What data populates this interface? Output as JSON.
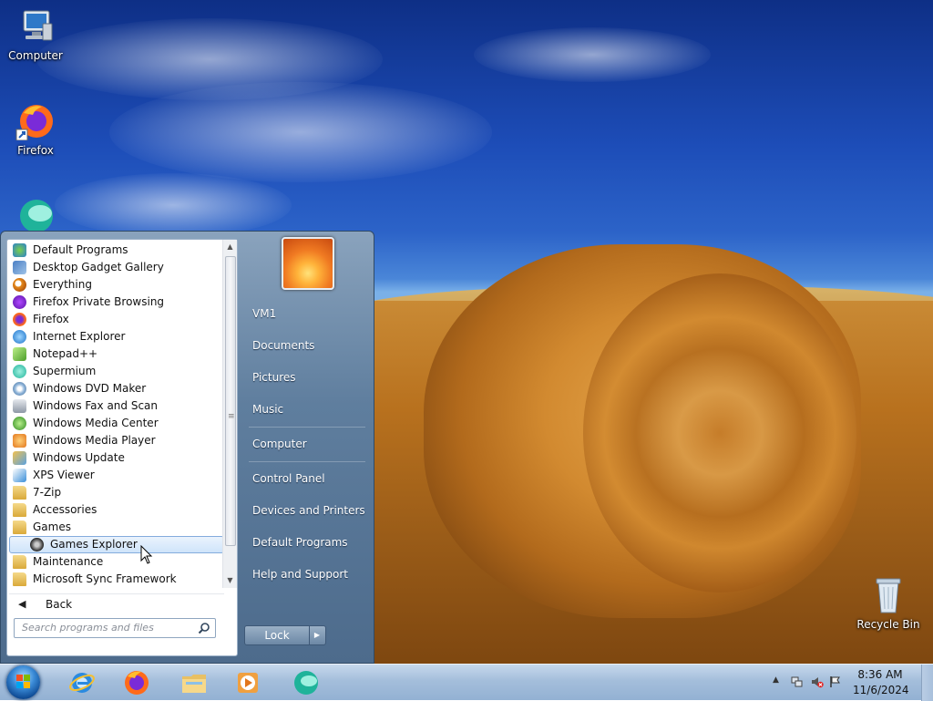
{
  "desktop": {
    "icons": [
      {
        "label": "Computer"
      },
      {
        "label": "Firefox"
      },
      {
        "label": "Recycle Bin"
      }
    ]
  },
  "start_menu": {
    "programs": [
      {
        "label": "Default Programs",
        "icon": "default-programs-icon"
      },
      {
        "label": "Desktop Gadget Gallery",
        "icon": "gadget-gallery-icon"
      },
      {
        "label": "Everything",
        "icon": "everything-search-icon"
      },
      {
        "label": "Firefox Private Browsing",
        "icon": "firefox-private-icon"
      },
      {
        "label": "Firefox",
        "icon": "firefox-icon"
      },
      {
        "label": "Internet Explorer",
        "icon": "internet-explorer-icon"
      },
      {
        "label": "Notepad++",
        "icon": "notepad-plus-plus-icon"
      },
      {
        "label": "Supermium",
        "icon": "supermium-icon"
      },
      {
        "label": "Windows DVD Maker",
        "icon": "dvd-maker-icon"
      },
      {
        "label": "Windows Fax and Scan",
        "icon": "fax-scan-icon"
      },
      {
        "label": "Windows Media Center",
        "icon": "media-center-icon"
      },
      {
        "label": "Windows Media Player",
        "icon": "media-player-icon"
      },
      {
        "label": "Windows Update",
        "icon": "windows-update-icon"
      },
      {
        "label": "XPS Viewer",
        "icon": "xps-viewer-icon"
      },
      {
        "label": "7-Zip",
        "icon": "folder-icon"
      },
      {
        "label": "Accessories",
        "icon": "folder-icon"
      },
      {
        "label": "Games",
        "icon": "folder-icon"
      },
      {
        "label": "Games Explorer",
        "icon": "games-explorer-icon"
      },
      {
        "label": "Maintenance",
        "icon": "folder-icon"
      },
      {
        "label": "Microsoft Sync Framework",
        "icon": "folder-icon"
      }
    ],
    "back_label": "Back",
    "search_placeholder": "Search programs and files",
    "right_links": [
      {
        "label": "VM1"
      },
      {
        "label": "Documents"
      },
      {
        "label": "Pictures"
      },
      {
        "label": "Music"
      },
      {
        "label": "Computer"
      },
      {
        "label": "Control Panel"
      },
      {
        "label": "Devices and Printers"
      },
      {
        "label": "Default Programs"
      },
      {
        "label": "Help and Support"
      }
    ],
    "lock_label": "Lock"
  },
  "taskbar": {
    "pinned": [
      "internet-explorer-icon",
      "firefox-icon",
      "file-explorer-icon",
      "media-player-icon",
      "supermium-icon"
    ],
    "clock_time": "8:36 AM",
    "clock_date": "11/6/2024"
  },
  "colors": {
    "accent": "#84acdd",
    "taskbar": "#a4bedb",
    "start_menu": "#5f7e9e"
  }
}
